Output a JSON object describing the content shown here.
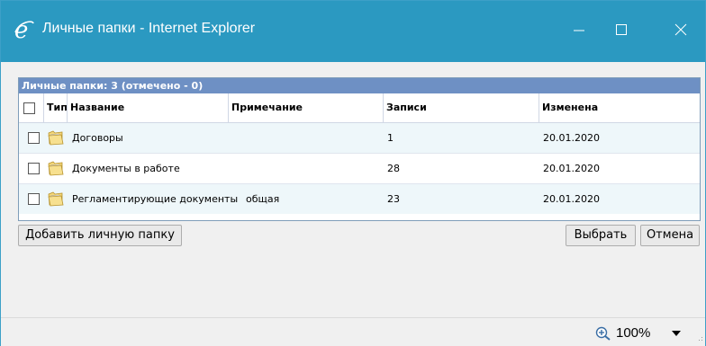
{
  "window": {
    "title": "Личные папки - Internet Explorer",
    "accent_color": "#2b99c1",
    "icons": {
      "logo": "ie-logo-icon",
      "minimize": "minimize-icon",
      "maximize": "maximize-icon",
      "close": "close-icon"
    }
  },
  "grid": {
    "caption": "Личные папки: 3 (отмечено - 0)",
    "caption_color": "#6e90c4",
    "columns": {
      "type": "Тип",
      "name": "Название",
      "note": "Примечание",
      "records": "Записи",
      "modified": "Изменена"
    },
    "rows": [
      {
        "name": "Договоры",
        "note": "",
        "records": "1",
        "modified": "20.01.2020",
        "checked": false,
        "icon": "folder-icon"
      },
      {
        "name": "Документы в работе",
        "note": "",
        "records": "28",
        "modified": "20.01.2020",
        "checked": false,
        "icon": "folder-icon"
      },
      {
        "name": "Регламентирующие документы",
        "note": "общая",
        "records": "23",
        "modified": "20.01.2020",
        "checked": false,
        "icon": "folder-icon"
      }
    ]
  },
  "buttons": {
    "add": "Добавить личную папку",
    "select": "Выбрать",
    "cancel": "Отмена"
  },
  "statusbar": {
    "zoom": "100%",
    "icons": {
      "zoom": "zoom-in-icon",
      "dropdown": "chevron-down-icon"
    }
  }
}
